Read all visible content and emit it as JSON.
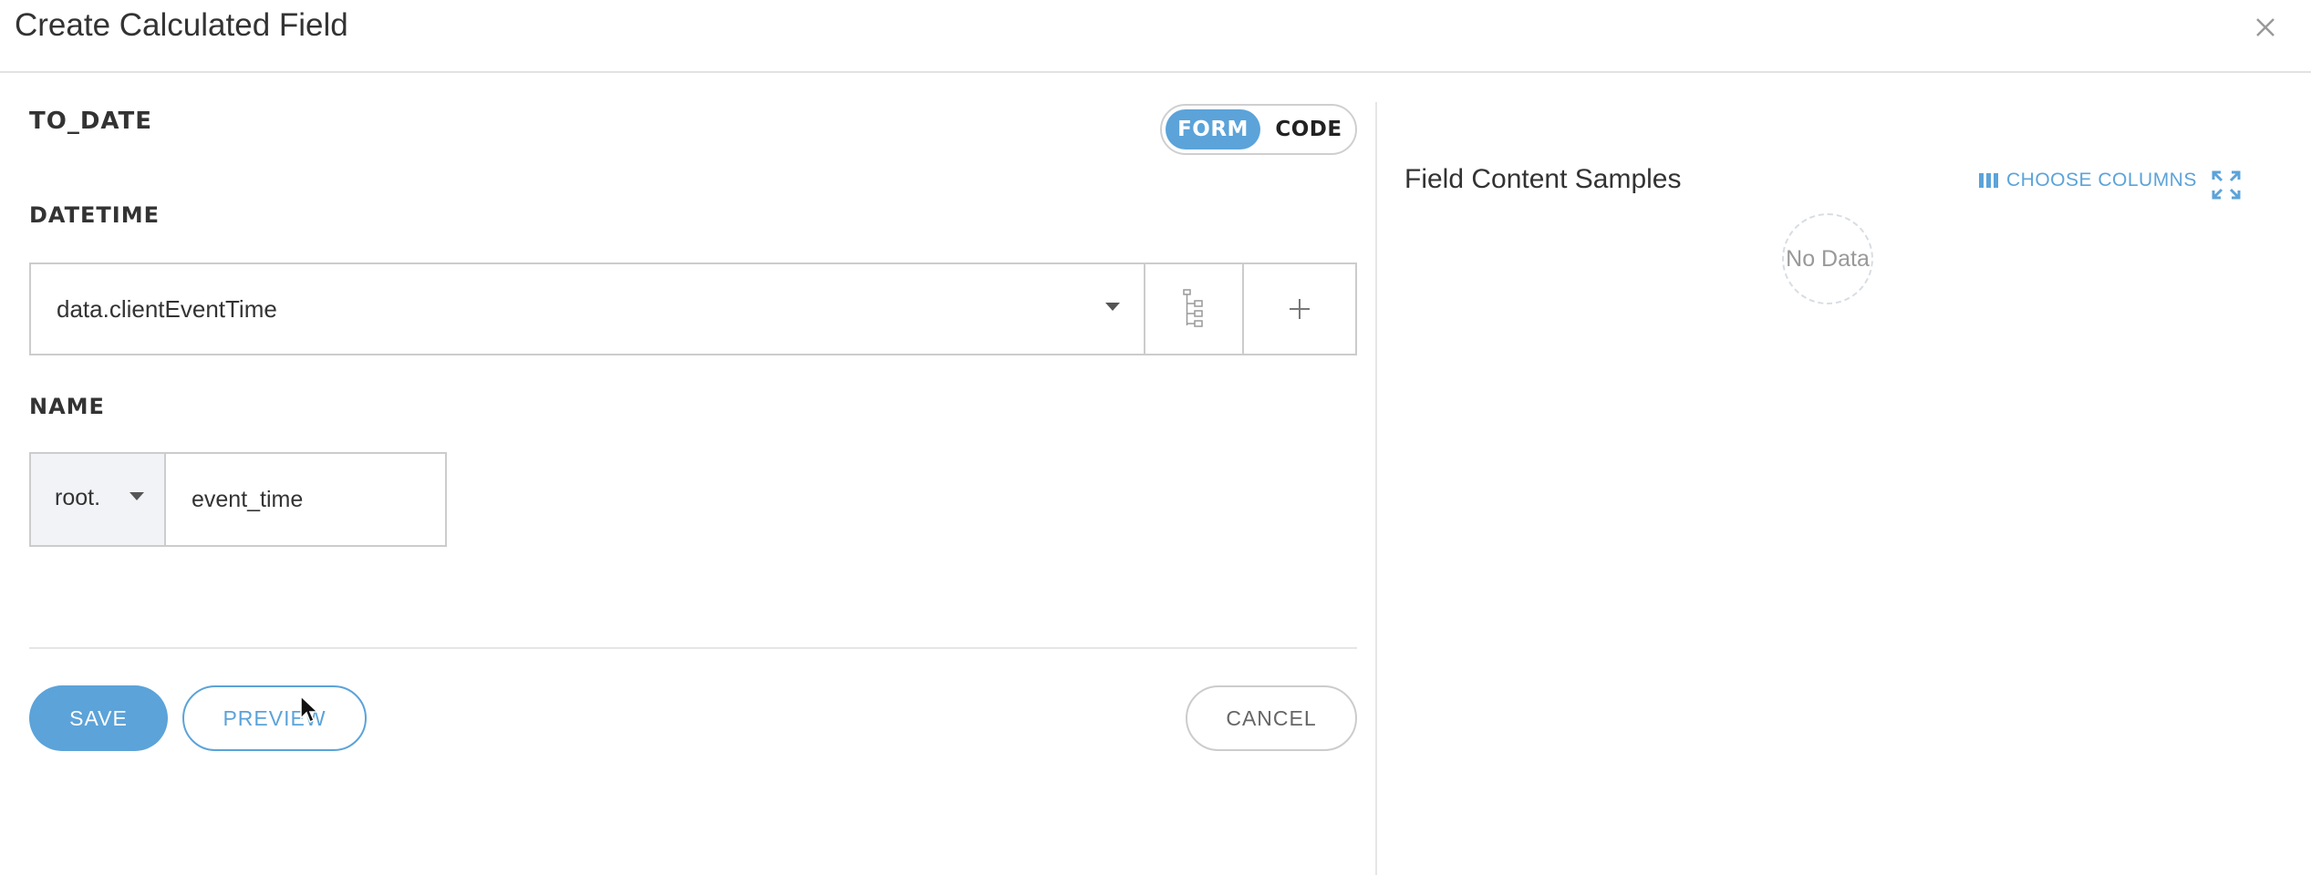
{
  "dialog": {
    "title": "Create Calculated Field",
    "close_icon": "close-icon"
  },
  "form": {
    "function_name": "TO_DATE",
    "mode_toggle": {
      "form_label": "FORM",
      "code_label": "CODE",
      "selected": "FORM"
    },
    "datetime": {
      "label": "DATETIME",
      "selected_value": "data.clientEventTime",
      "tree_icon": "tree-icon",
      "add_icon": "plus-icon"
    },
    "name": {
      "label": "NAME",
      "prefix_value": "root.",
      "value": "event_time"
    }
  },
  "actions": {
    "save_label": "SAVE",
    "preview_label": "PREVIEW",
    "cancel_label": "CANCEL"
  },
  "samples": {
    "title": "Field Content Samples",
    "choose_columns_label": "CHOOSE COLUMNS",
    "expand_icon": "expand-icon",
    "empty_text": "No Data"
  },
  "colors": {
    "accent": "#5ba3d9",
    "border": "#cccccc",
    "text": "#333333"
  }
}
